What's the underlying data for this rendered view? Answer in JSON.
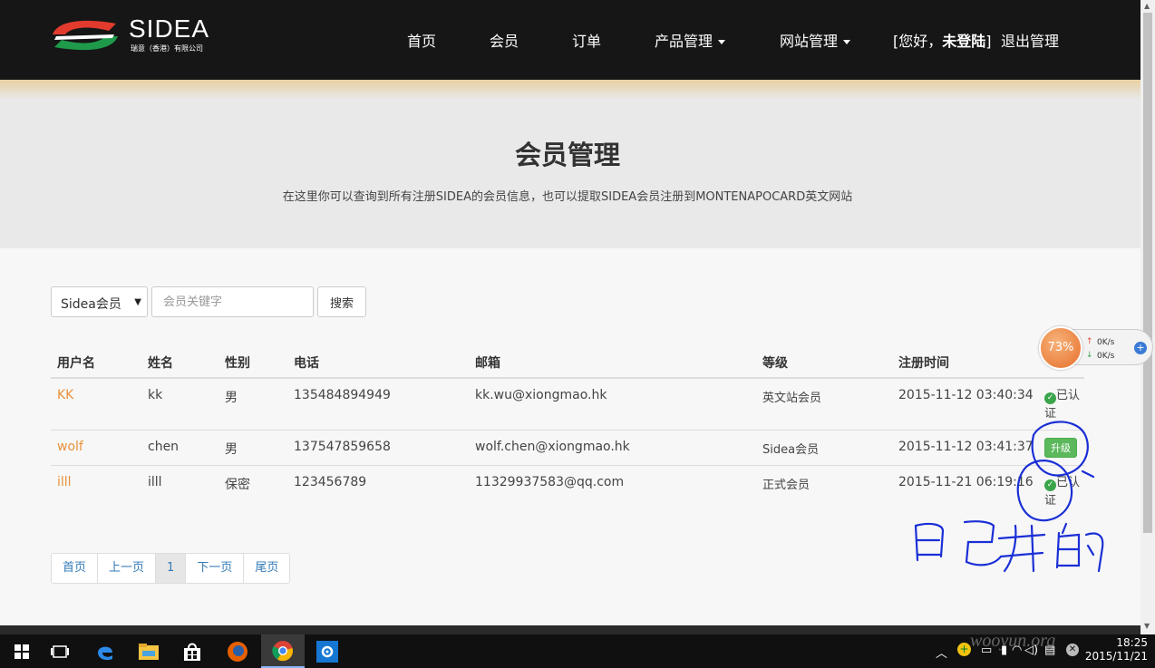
{
  "header": {
    "logo_text": "SIDEA",
    "logo_sub": "瑞意（香港）有限公司",
    "nav": [
      "首页",
      "会员",
      "订单",
      "产品管理",
      "网站管理"
    ],
    "greeting_prefix": "[您好，",
    "greeting_user": "未登陆",
    "greeting_suffix": "]",
    "logout": "退出管理"
  },
  "hero": {
    "title": "会员管理",
    "subtitle": "在这里你可以查询到所有注册SIDEA的会员信息，也可以提取SIDEA会员注册到MONTENAPOCARD英文网站"
  },
  "search": {
    "select_value": "Sidea会员",
    "placeholder": "会员关键字",
    "button": "搜索"
  },
  "table": {
    "headers": [
      "用户名",
      "姓名",
      "性别",
      "电话",
      "邮箱",
      "等级",
      "注册时间"
    ],
    "rows": [
      {
        "username": "KK",
        "name": "kk",
        "gender": "男",
        "phone": "135484894949",
        "email": "kk.wu@xiongmao.hk",
        "level": "英文站会员",
        "registered": "2015-11-12 03:40:34",
        "status": "已认证"
      },
      {
        "username": "wolf",
        "name": "chen",
        "gender": "男",
        "phone": "137547859658",
        "email": "wolf.chen@xiongmao.hk",
        "level": "Sidea会员",
        "registered": "2015-11-12 03:41:37",
        "status": "升级"
      },
      {
        "username": "illl",
        "name": "illl",
        "gender": "保密",
        "phone": "123456789",
        "email": "11329937583@qq.com",
        "level": "正式会员",
        "registered": "2015-11-21 06:19:16",
        "status": "已认证"
      }
    ]
  },
  "pagination": [
    "首页",
    "上一页",
    "1",
    "下一页",
    "尾页"
  ],
  "net_widget": {
    "percent": "73%",
    "upload": "0K/s",
    "download": "0K/s"
  },
  "taskbar": {
    "time": "18:25",
    "date": "2015/11/21",
    "watermark": "wooyun.org"
  },
  "colors": {
    "nav_bg": "#161616",
    "hero_bg": "#e9e9e9",
    "link_orange": "#e8913c",
    "upgrade_green": "#5cb85c",
    "annotation_blue": "#1a2fd6"
  },
  "icons": [
    "logo-swoosh-icon",
    "caret-down-icon",
    "check-circle-icon",
    "windows-start-icon",
    "task-view-icon",
    "edge-icon",
    "file-explorer-icon",
    "store-icon",
    "firefox-icon",
    "chrome-icon",
    "settings-icon",
    "plus-icon"
  ]
}
